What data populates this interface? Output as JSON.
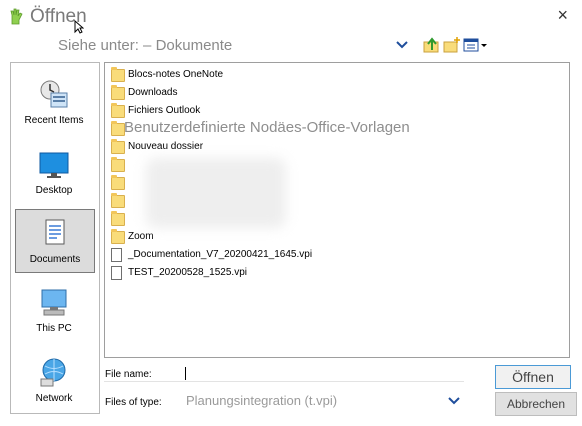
{
  "window": {
    "title": "Öffnen",
    "close_label": "×"
  },
  "lookin": {
    "label": "Siehe unter: – Dokumente"
  },
  "places": [
    {
      "label": "Recent Items"
    },
    {
      "label": "Desktop"
    },
    {
      "label": "Documents",
      "selected": true
    },
    {
      "label": "This PC"
    },
    {
      "label": "Network"
    }
  ],
  "files": [
    {
      "name": "Blocs-notes OneNote",
      "type": "folder"
    },
    {
      "name": "Downloads",
      "type": "folder"
    },
    {
      "name": "Fichiers Outlook",
      "type": "folder"
    },
    {
      "name": "",
      "type": "folder"
    },
    {
      "name": "Nouveau dossier",
      "type": "folder"
    },
    {
      "name": "",
      "type": "folder"
    },
    {
      "name": "",
      "type": "folder"
    },
    {
      "name": "",
      "type": "folder"
    },
    {
      "name": "",
      "type": "folder"
    },
    {
      "name": "Zoom",
      "type": "folder"
    },
    {
      "name": "_Documentation_V7_20200421_1645.vpi",
      "type": "file"
    },
    {
      "name": "TEST_20200528_1525.vpi",
      "type": "file"
    }
  ],
  "overlay_folder_label": "Benutzerdefinierte Nodäes-Office-Vorlagen",
  "filename": {
    "label": "File name:",
    "value": ""
  },
  "filetype": {
    "label": "Files of type:",
    "value": "Planungsintegration (t.vpi)"
  },
  "buttons": {
    "open": "Öffnen",
    "cancel": "Abbrechen"
  },
  "colors": {
    "folder": "#f9dc7a",
    "accent_border": "#4b9ad6",
    "selected_place": "#dcdcdc"
  }
}
